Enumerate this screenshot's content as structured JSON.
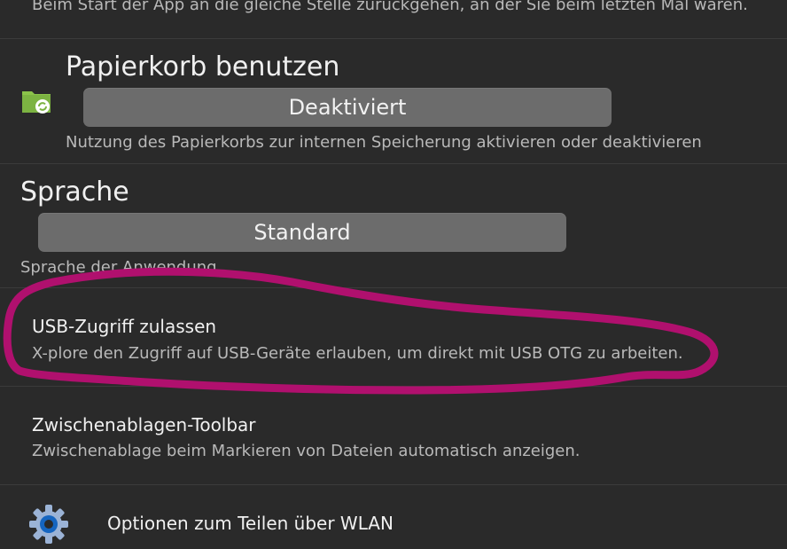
{
  "resume": {
    "description": "Beim Start der App an die gleiche Stelle zurückgehen, an der Sie beim letzten Mal waren."
  },
  "trash": {
    "title": "Papierkorb benutzen",
    "button_label": "Deaktiviert",
    "description": "Nutzung des Papierkorbs zur internen Speicherung aktivieren oder deaktivieren",
    "icon": "folder-recycle-icon"
  },
  "language": {
    "title": "Sprache",
    "button_label": "Standard",
    "description": "Sprache der Anwendung"
  },
  "usb": {
    "title": "USB-Zugriff zulassen",
    "description": "X-plore den Zugriff auf USB-Geräte erlauben, um direkt mit USB OTG zu arbeiten."
  },
  "clipboard": {
    "title": "Zwischenablagen-Toolbar",
    "description": "Zwischenablage beim Markieren von Dateien automatisch anzeigen."
  },
  "wifi_share": {
    "title": "Optionen zum Teilen über WLAN",
    "icon": "gear-icon"
  },
  "colors": {
    "background": "#2a2a2a",
    "button": "#6c6c6c",
    "annotation": "#b0106e",
    "folder_green": "#8bc34a"
  }
}
